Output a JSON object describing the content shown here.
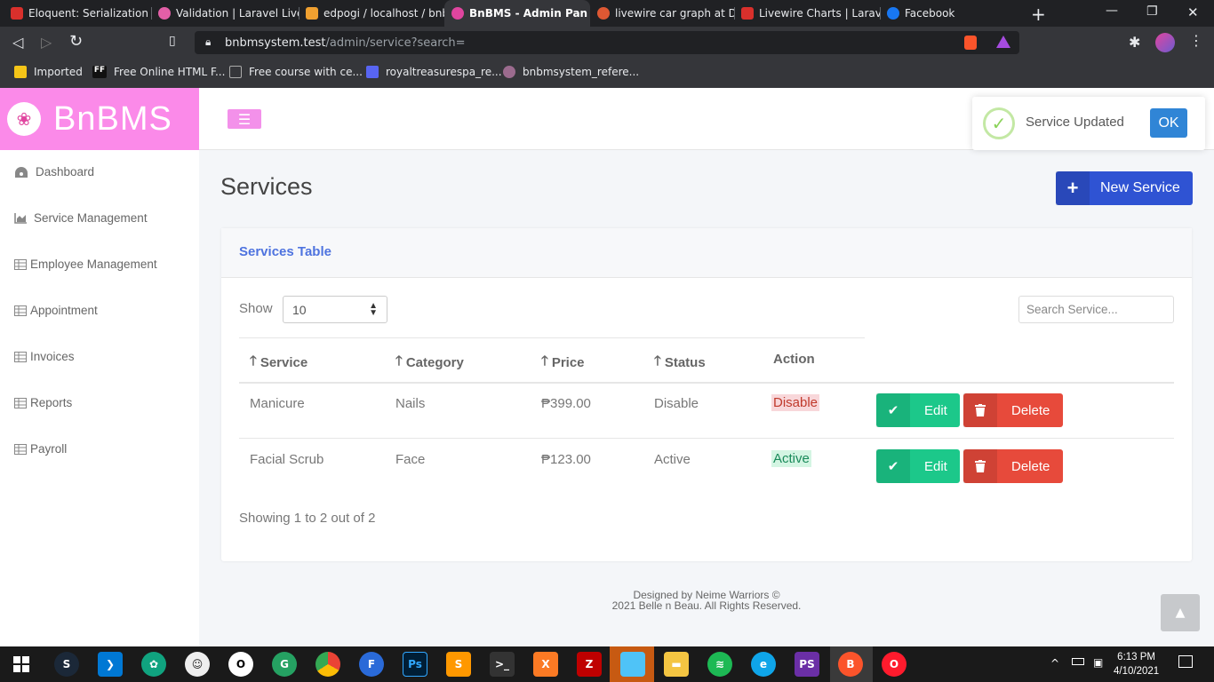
{
  "browser": {
    "tabs": [
      {
        "title": "Eloquent: Serialization -",
        "color": "#d9302c"
      },
      {
        "title": "Validation | Laravel Livev",
        "color": "#e35fa7"
      },
      {
        "title": "edpogi / localhost / bnb",
        "color": "#f0a030"
      },
      {
        "title": "BnBMS - Admin Pan",
        "color": "#e0459f"
      },
      {
        "title": "livewire car graph at Du",
        "color": "#de5833"
      },
      {
        "title": "Livewire Charts | Laravel",
        "color": "#d9302c"
      },
      {
        "title": "Facebook",
        "color": "#1877f2"
      }
    ],
    "url_host": "bnbmsystem.test",
    "url_path": "/admin/service?search=",
    "bookmarks": [
      {
        "label": "Imported",
        "color": "#f5c518"
      },
      {
        "label": "Free Online HTML F...",
        "color": "#111111"
      },
      {
        "label": "Free course with ce...",
        "color": "#555555"
      },
      {
        "label": "royaltreasurespa_re...",
        "color": "#5865f2"
      },
      {
        "label": "bnbmsystem_refere...",
        "color": "#9b6b8e"
      }
    ]
  },
  "brand": {
    "name": "BnBMS",
    "color": "#fb8ae9"
  },
  "sidebar": {
    "items": [
      {
        "label": "Dashboard",
        "icon": "gauge-icon"
      },
      {
        "label": "Service Management",
        "icon": "chart-area-icon"
      },
      {
        "label": "Employee Management",
        "icon": "table-icon"
      },
      {
        "label": "Appointment",
        "icon": "table-icon"
      },
      {
        "label": "Invoices",
        "icon": "table-icon"
      },
      {
        "label": "Reports",
        "icon": "table-icon"
      },
      {
        "label": "Payroll",
        "icon": "table-icon"
      }
    ]
  },
  "toast": {
    "message": "Service Updated",
    "ok_label": "OK"
  },
  "page": {
    "title": "Services",
    "new_button": "New Service"
  },
  "card": {
    "title": "Services Table"
  },
  "controls": {
    "show_label": "Show",
    "show_value": "10",
    "search_placeholder": "Search Service..."
  },
  "table": {
    "headers": [
      "Service",
      "Category",
      "Price",
      "Status",
      "Action"
    ],
    "rows": [
      {
        "service": "Manicure",
        "category": "Nails",
        "price": "₱399.00",
        "status": "Disable",
        "action": "Disable"
      },
      {
        "service": "Facial Scrub",
        "category": "Face",
        "price": "₱123.00",
        "status": "Active",
        "action": "Active"
      }
    ],
    "edit_label": "Edit",
    "delete_label": "Delete"
  },
  "pagination": {
    "summary": "Showing 1 to 2 out of 2"
  },
  "footer": {
    "line1": "Designed by Neime Warriors ©",
    "line2": "2021 Belle n Beau. All Rights Reserved."
  },
  "clock": {
    "time": "6:13 PM",
    "date": "4/10/2021"
  },
  "colors": {
    "primary": "#4e73df",
    "success": "#1cc88a",
    "danger": "#e74a3b",
    "new_button": "#2f53d3",
    "disable_badge_bg": "#f8d7da",
    "active_badge_bg": "#d4f5e3"
  }
}
